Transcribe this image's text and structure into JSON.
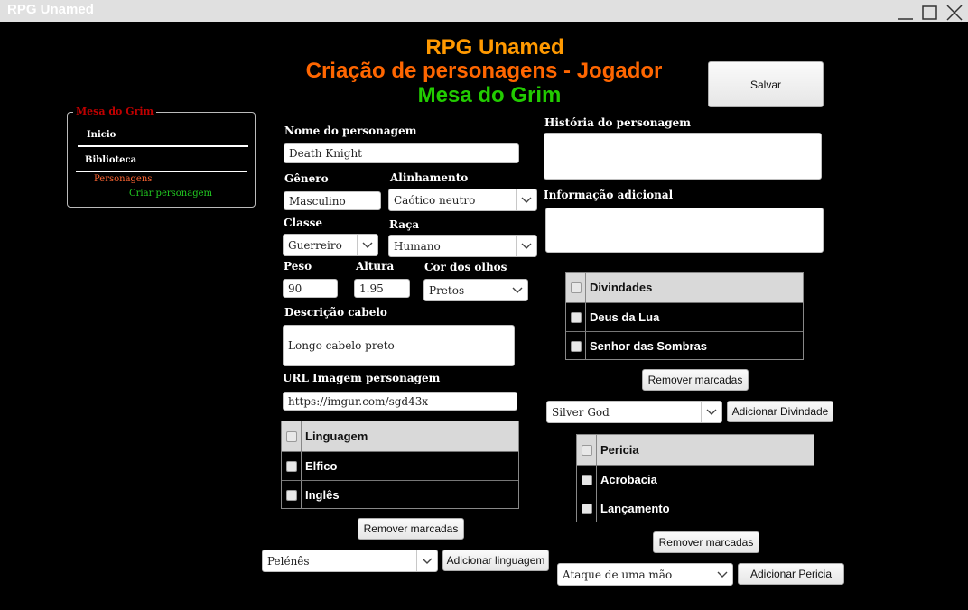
{
  "window": {
    "title": "RPG Unamed"
  },
  "header": {
    "title": "RPG Unamed",
    "subtitle": "Criação de personagens - Jogador",
    "table_name": "Mesa do Grim",
    "colors": {
      "title": "#ff9900",
      "subtitle": "#ff6600",
      "table_name": "#22cc00"
    }
  },
  "save_button": "Salvar",
  "sidebar": {
    "legend": "Mesa do Grim",
    "items": [
      {
        "label": "Inicio"
      },
      {
        "label": "Biblioteca"
      },
      {
        "label": "Personagens",
        "color": "#ff6633"
      },
      {
        "label": "Criar personagem",
        "color": "#22cc22"
      }
    ]
  },
  "form": {
    "name": {
      "label": "Nome do personagem",
      "value": "Death Knight"
    },
    "gender": {
      "label": "Gênero",
      "value": "Masculino"
    },
    "alignment": {
      "label": "Alinhamento",
      "value": "Caótico neutro"
    },
    "class": {
      "label": "Classe",
      "value": "Guerreiro"
    },
    "race": {
      "label": "Raça",
      "value": "Humano"
    },
    "weight": {
      "label": "Peso",
      "value": "90"
    },
    "height": {
      "label": "Altura",
      "value": "1.95"
    },
    "eye_color": {
      "label": "Cor dos olhos",
      "value": "Pretos"
    },
    "hair": {
      "label": "Descrição cabelo",
      "value": "Longo cabelo preto"
    },
    "image_url": {
      "label": "URL Imagem personagem",
      "value": "https://imgur.com/sgd43x"
    },
    "story": {
      "label": "História do personagem",
      "value": ""
    },
    "extra_info": {
      "label": "Informação adicional",
      "value": ""
    }
  },
  "languages": {
    "header": "Linguagem",
    "rows": [
      "Elfico",
      "Inglês"
    ],
    "remove_button": "Remover marcadas",
    "combo_value": "Pelénês",
    "add_button": "Adicionar linguagem"
  },
  "deities": {
    "header": "Divindades",
    "rows": [
      "Deus da Lua",
      "Senhor das Sombras"
    ],
    "remove_button": "Remover marcadas",
    "combo_value": "Silver God",
    "add_button": "Adicionar Divindade"
  },
  "skills": {
    "header": "Pericia",
    "rows": [
      "Acrobacia",
      "Lançamento"
    ],
    "remove_button": "Remover marcadas",
    "combo_value": "Ataque de uma mão",
    "add_button": "Adicionar Pericia"
  },
  "icons": {
    "minimize": "minimize-icon",
    "maximize": "maximize-icon",
    "close": "close-icon",
    "combo_arrow": "chevron-down-icon"
  }
}
